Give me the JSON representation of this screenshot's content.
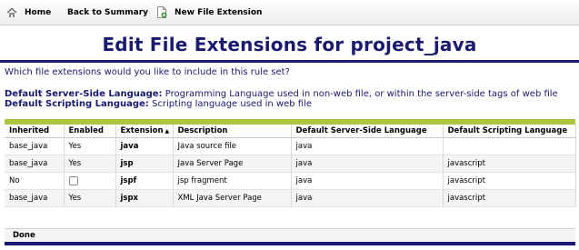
{
  "toolbar": {
    "home_label": "Home",
    "back_label": "Back to Summary",
    "new_ext_label": "New File Extension"
  },
  "page": {
    "title": "Edit File Extensions for project_java",
    "question": "Which file extensions would you like to include in this rule set?",
    "server_side_term": "Default Server-Side Language:",
    "server_side_desc": "Programming Language used in non-web file, or within the server-side tags of web file",
    "scripting_term": "Default Scripting Language:",
    "scripting_desc": "Scripting language used in web file"
  },
  "table": {
    "headers": {
      "inherited": "Inherited",
      "enabled": "Enabled",
      "extension": "Extension",
      "description": "Description",
      "server_lang": "Default Server-Side Language",
      "script_lang": "Default Scripting Language"
    },
    "sort_indicator": "▲",
    "rows": [
      {
        "inherited": "base_java",
        "enabled": "Yes",
        "extension": "java",
        "description": "Java source file",
        "server_lang": "java",
        "script_lang": ""
      },
      {
        "inherited": "base_java",
        "enabled": "Yes",
        "extension": "jsp",
        "description": "Java Server Page",
        "server_lang": "java",
        "script_lang": "javascript"
      },
      {
        "inherited": "No",
        "enabled": "",
        "extension": "jspf",
        "description": "jsp fragment",
        "server_lang": "java",
        "script_lang": "javascript"
      },
      {
        "inherited": "base_java",
        "enabled": "Yes",
        "extension": "jspx",
        "description": "XML Java Server Page",
        "server_lang": "java",
        "script_lang": "javascript"
      }
    ]
  },
  "footer": {
    "done_label": "Done"
  },
  "colors": {
    "title": "#1a1a6e",
    "rule": "#191970",
    "accent_green": "#a9c63e"
  },
  "icons": {
    "home": "house-icon",
    "back": "back-arrow-icon",
    "new_file": "new-file-icon"
  }
}
